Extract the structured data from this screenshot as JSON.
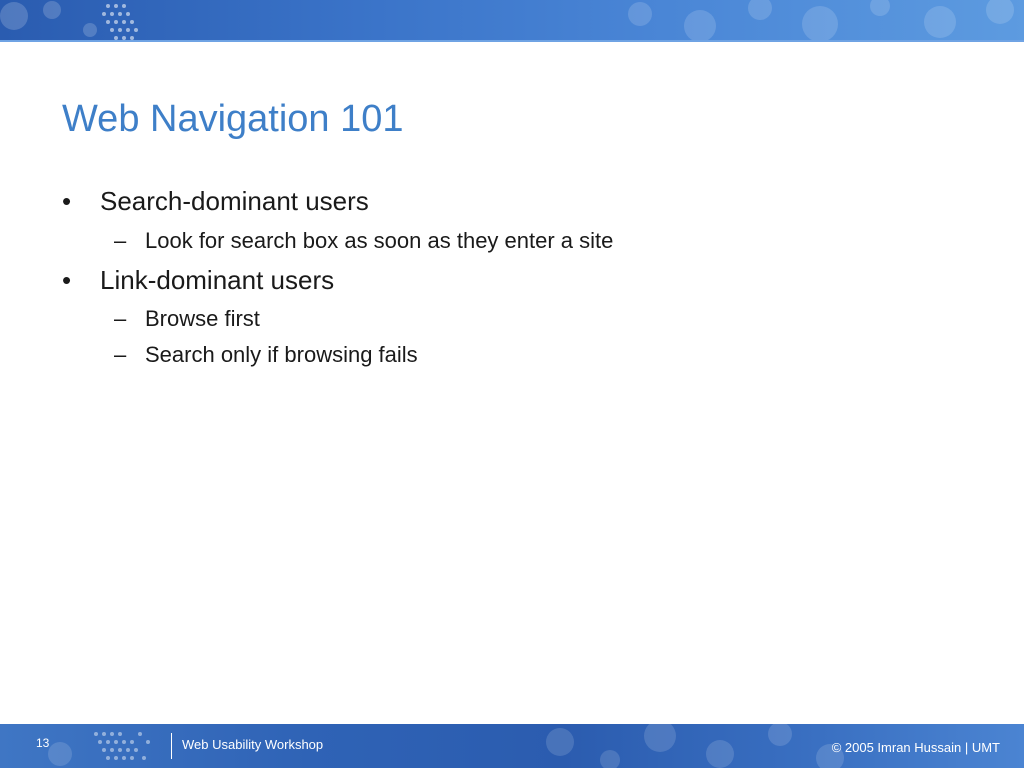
{
  "slide": {
    "title": "Web Navigation 101",
    "bullets": [
      {
        "text": "Search-dominant users",
        "sub": [
          "Look for search box as soon as they enter a site"
        ]
      },
      {
        "text": "Link-dominant users",
        "sub": [
          "Browse first",
          "Search only if browsing fails"
        ]
      }
    ],
    "bullet_marker": "•",
    "sub_marker": "–"
  },
  "footer": {
    "slide_number": "13",
    "left_text": "Web Usability Workshop",
    "right_text": "© 2005 Imran Hussain | UMT"
  },
  "colors": {
    "title": "#3e7fc8",
    "banner": "#2f63b6",
    "text": "#1a1a1a"
  }
}
